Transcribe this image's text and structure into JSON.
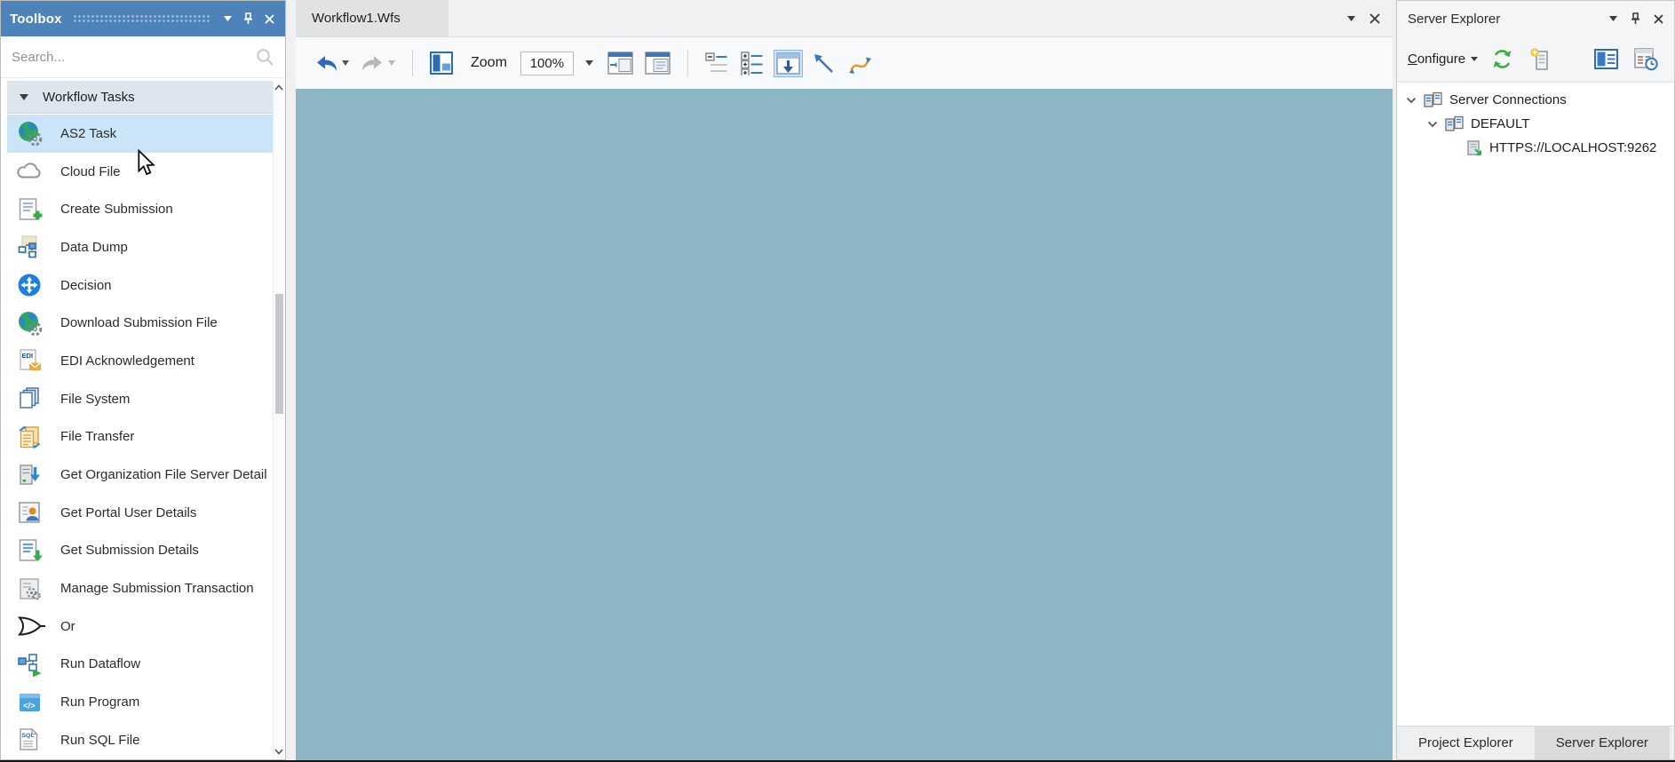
{
  "toolbox": {
    "title": "Toolbox",
    "search_placeholder": "Search...",
    "section_label": "Workflow Tasks",
    "tasks": [
      {
        "label": "AS2 Task",
        "icon": "globe-gear-icon",
        "selected": true
      },
      {
        "label": "Cloud File",
        "icon": "cloud-icon",
        "selected": false
      },
      {
        "label": "Create Submission",
        "icon": "document-plus-icon",
        "selected": false
      },
      {
        "label": "Data Dump",
        "icon": "page-flowchart-icon",
        "selected": false
      },
      {
        "label": "Decision",
        "icon": "decision-arrows-icon",
        "selected": false
      },
      {
        "label": "Download Submission File",
        "icon": "globe-gear-icon",
        "selected": false
      },
      {
        "label": "EDI Acknowledgement",
        "icon": "edi-document-icon",
        "selected": false
      },
      {
        "label": "File System",
        "icon": "file-stack-icon",
        "selected": false
      },
      {
        "label": "File Transfer",
        "icon": "file-transfer-icon",
        "selected": false
      },
      {
        "label": "Get Organization File Server Detail",
        "icon": "server-download-icon",
        "selected": false
      },
      {
        "label": "Get Portal User Details",
        "icon": "user-card-icon",
        "selected": false
      },
      {
        "label": "Get Submission Details",
        "icon": "document-download-icon",
        "selected": false
      },
      {
        "label": "Manage Submission Transaction",
        "icon": "document-gears-icon",
        "selected": false
      },
      {
        "label": "Or",
        "icon": "or-gate-icon",
        "selected": false
      },
      {
        "label": "Run Dataflow",
        "icon": "flow-play-icon",
        "selected": false
      },
      {
        "label": "Run Program",
        "icon": "program-window-icon",
        "selected": false
      },
      {
        "label": "Run SQL File",
        "icon": "sql-file-icon",
        "selected": false
      }
    ]
  },
  "editor": {
    "tab_label": "Workflow1.Wfs",
    "zoom_label": "Zoom",
    "zoom_value": "100%"
  },
  "server_explorer": {
    "title": "Server Explorer",
    "configure_label": "Configure",
    "tree": [
      {
        "label": "Server Connections",
        "level": 0,
        "icon": "server-stack-icon"
      },
      {
        "label": "DEFAULT",
        "level": 1,
        "icon": "server-stack-icon"
      },
      {
        "label": "HTTPS://LOCALHOST:9262",
        "level": 2,
        "icon": "server-link-icon"
      }
    ]
  },
  "bottom_tabs": {
    "project_label": "Project Explorer",
    "server_label": "Server Explorer"
  },
  "colors": {
    "toolbox_header_blue": "#4d83b9",
    "canvas_blue": "#8eb5c6",
    "selected_row": "#cbe5f8",
    "section_header": "#dde6ef",
    "selected_tool_bg": "#cfe4f7",
    "accent_green": "#2fae47",
    "accent_blue": "#3a78c2",
    "accent_orange": "#e59a2f"
  }
}
